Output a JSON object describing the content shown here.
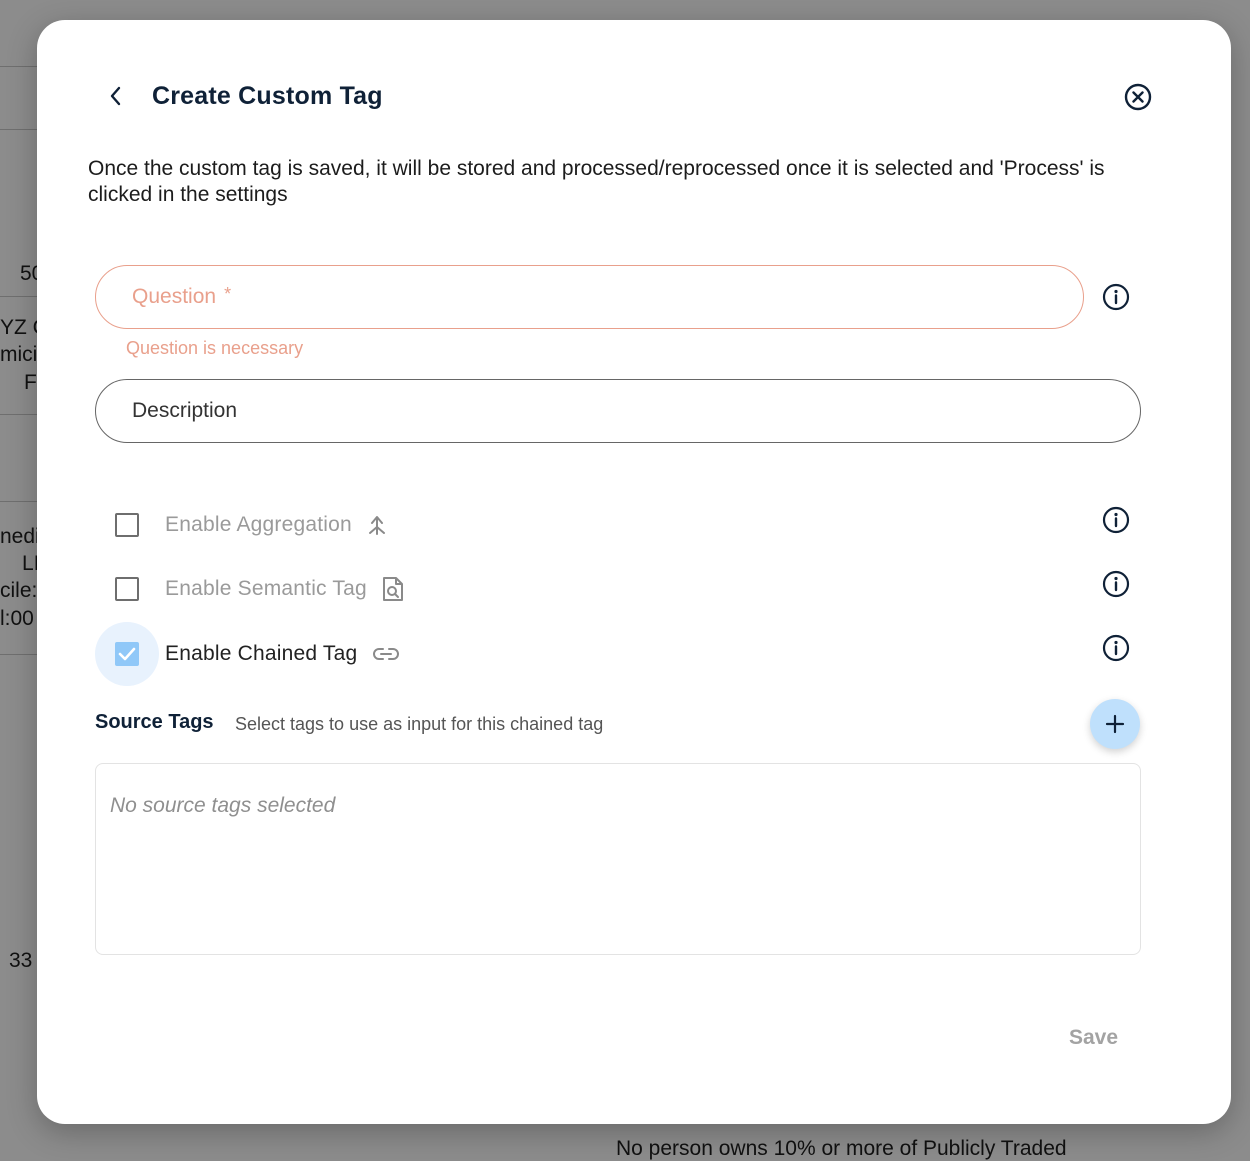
{
  "background": {
    "fragments": [
      "50",
      "YZ C",
      "mici",
      "F",
      "nedi",
      "LI",
      "cile:",
      "l:00",
      "33",
      "No person owns 10% or more of Publicly Traded"
    ]
  },
  "modal": {
    "title": "Create Custom Tag",
    "description": "Once the custom tag is saved, it will be stored and processed/reprocessed once it is selected and 'Process' is clicked in the settings",
    "question": {
      "placeholder": "Question",
      "required_mark": "*",
      "error": "Question is necessary"
    },
    "description_field": {
      "placeholder": "Description"
    },
    "options": [
      {
        "label": "Enable Aggregation",
        "checked": false,
        "icon": "merge-arrow-icon"
      },
      {
        "label": "Enable Semantic Tag",
        "checked": false,
        "icon": "document-search-icon"
      },
      {
        "label": "Enable Chained Tag",
        "checked": true,
        "icon": "link-icon"
      }
    ],
    "source_tags": {
      "title": "Source Tags",
      "subtitle": "Select tags to use as input for this chained tag",
      "empty": "No source tags selected"
    },
    "save_label": "Save"
  },
  "colors": {
    "error": "#e9a08c",
    "title": "#0f2137",
    "checked": "#90c8f8",
    "add_button": "#bfe0fc"
  }
}
